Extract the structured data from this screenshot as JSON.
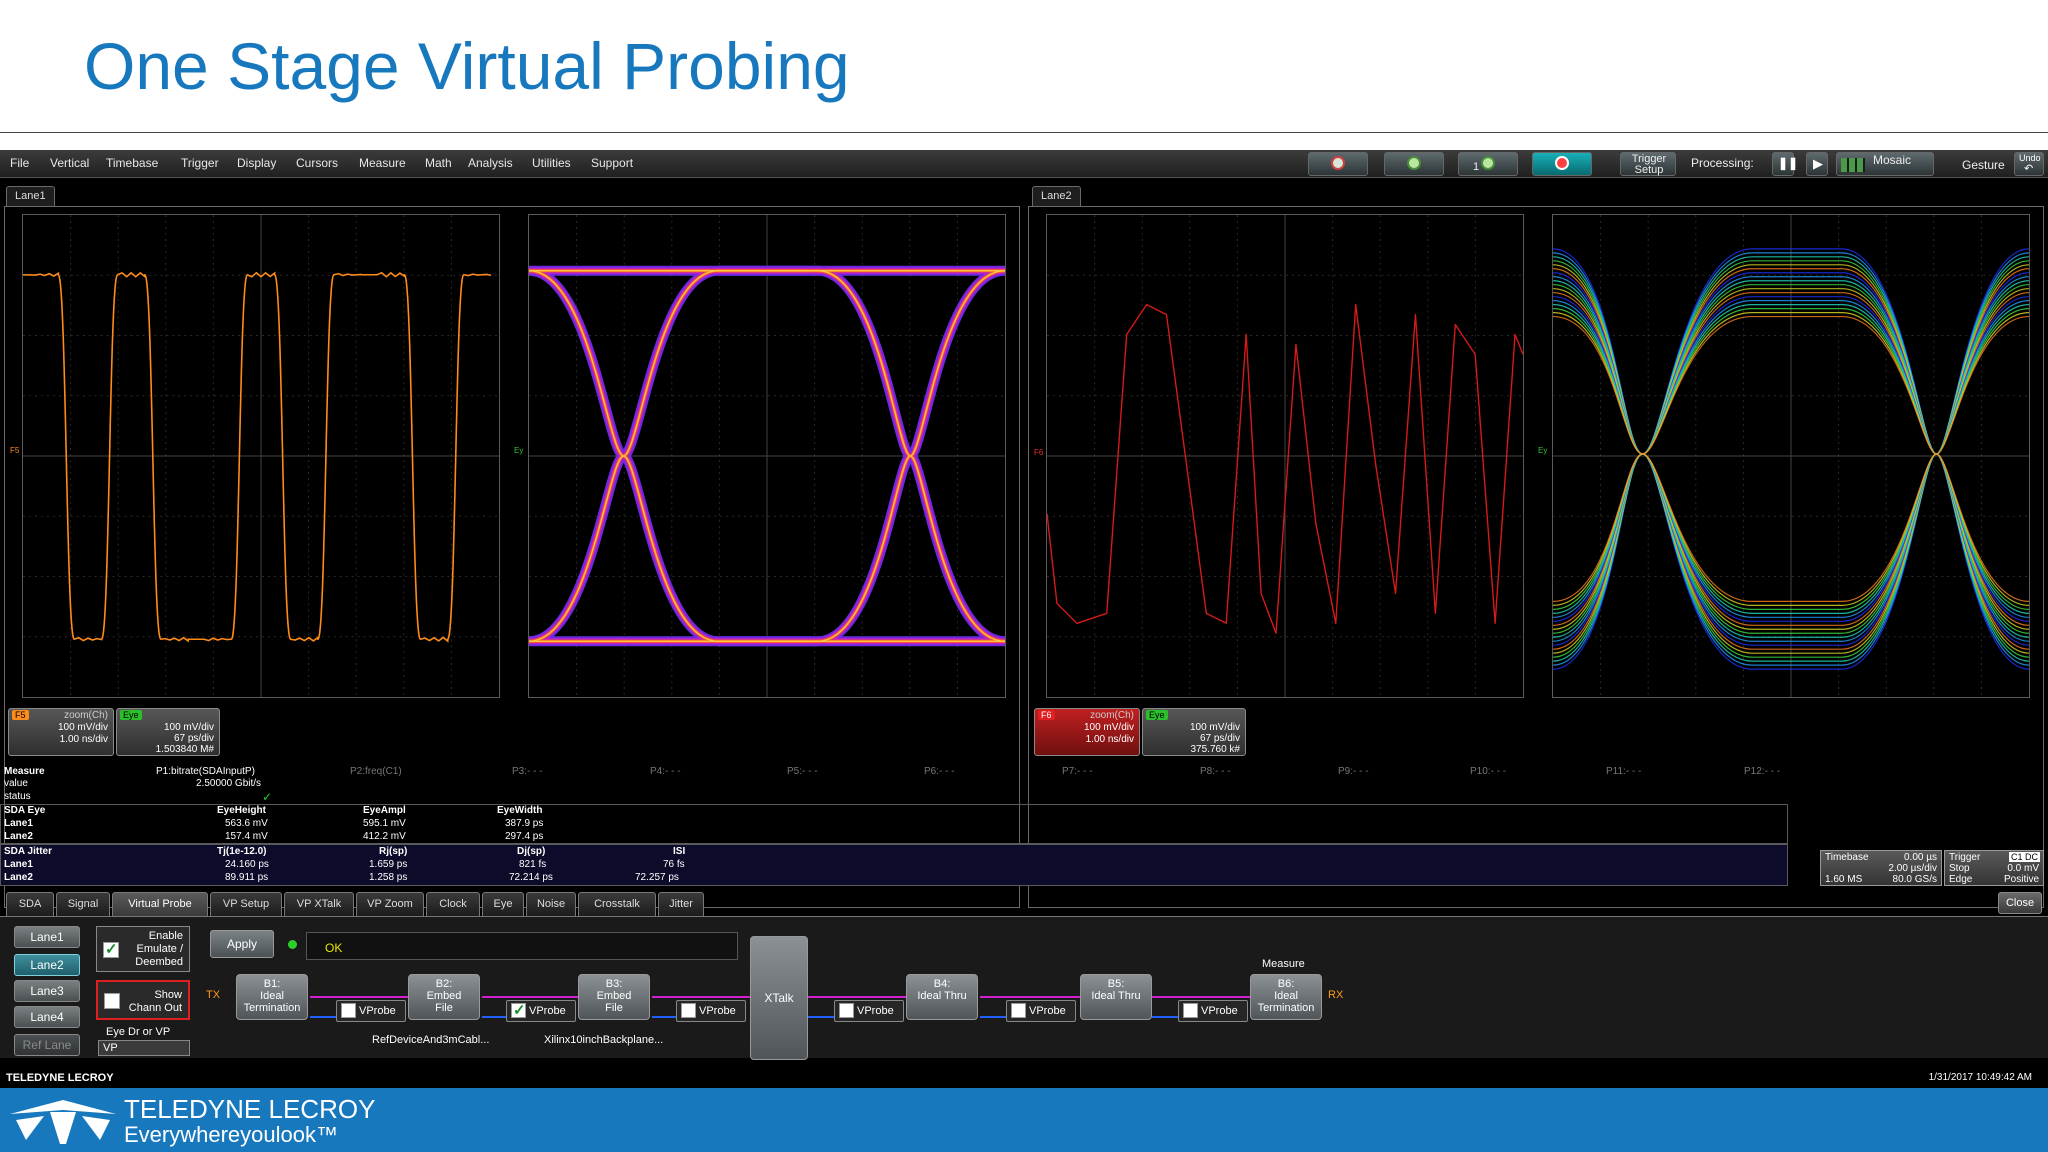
{
  "slide": {
    "title": "One Stage Virtual Probing"
  },
  "menu": [
    "File",
    "Vertical",
    "Timebase",
    "Trigger",
    "Display",
    "Cursors",
    "Measure",
    "Math",
    "Analysis",
    "Utilities",
    "Support"
  ],
  "toolbar": {
    "trigger_setup_line1": "Trigger",
    "trigger_setup_line2": "Setup",
    "processing_label": "Processing:",
    "mosaic_label": "Mosaic",
    "gesture_label": "Gesture",
    "undo_label": "Undo",
    "counter_label": "1"
  },
  "grids": {
    "lane1_tab": "Lane1",
    "lane2_tab": "Lane2",
    "marker_f5": "F5",
    "marker_f6": "F6",
    "marker_ey": "Ey",
    "lane1_zoom": {
      "tag": "F5",
      "name": "zoom(Ch)",
      "v": "100 mV/div",
      "t": "1.00 ns/div"
    },
    "lane1_eye": {
      "tag": "Eye",
      "v": "100 mV/div",
      "t": "67 ps/div",
      "n": "1.503840 M#"
    },
    "lane2_zoom": {
      "tag": "F6",
      "name": "zoom(Ch)",
      "v": "100 mV/div",
      "t": "1.00 ns/div"
    },
    "lane2_eye": {
      "tag": "Eye",
      "v": "100 mV/div",
      "t": "67 ps/div",
      "n": "375.760 k#"
    }
  },
  "colors": {
    "lane1_trace": "#ff8c1a",
    "lane2_trace": "#d41a1a",
    "accent_blue": "#1778be",
    "flow_magenta": "#d020d0",
    "flow_blue": "#2060ff"
  },
  "measure": {
    "header": "Measure",
    "row_value": "value",
    "row_status": "status",
    "p1": "P1:bitrate(SDAInputP)",
    "p1_value": "2.50000 Gbit/s",
    "params": [
      "P2:freq(C1)",
      "P3:- - -",
      "P4:- - -",
      "P5:- - -",
      "P6:- - -",
      "P7:- - -",
      "P8:- - -",
      "P9:- - -",
      "P10:- - -",
      "P11:- - -",
      "P12:- - -"
    ]
  },
  "sda_eye": {
    "title": "SDA Eye",
    "cols": [
      "EyeHeight",
      "EyeAmpl",
      "EyeWidth"
    ],
    "rows": [
      {
        "name": "Lane1",
        "vals": [
          "563.6 mV",
          "595.1 mV",
          "387.9 ps"
        ]
      },
      {
        "name": "Lane2",
        "vals": [
          "157.4 mV",
          "412.2 mV",
          "297.4 ps"
        ]
      }
    ]
  },
  "sda_jitter": {
    "title": "SDA Jitter",
    "cols": [
      "Tj(1e-12.0)",
      "Rj(sp)",
      "Dj(sp)",
      "ISI"
    ],
    "rows": [
      {
        "name": "Lane1",
        "vals": [
          "24.160 ps",
          "1.659 ps",
          "821 fs",
          "76 fs"
        ]
      },
      {
        "name": "Lane2",
        "vals": [
          "89.911 ps",
          "1.258 ps",
          "72.214 ps",
          "72.257 ps"
        ]
      }
    ]
  },
  "timebase": {
    "label": "Timebase",
    "delay": "0.00 µs",
    "div": "2.00 µs/div",
    "samples": "1.60 MS",
    "rate": "80.0 GS/s"
  },
  "trigger": {
    "label": "Trigger",
    "badge": "C1 DC",
    "mode": "Stop",
    "level": "0.0 mV",
    "type": "Edge",
    "slope": "Positive"
  },
  "dialog": {
    "tabs": [
      "SDA",
      "Signal",
      "Virtual Probe",
      "VP Setup",
      "VP XTalk",
      "VP Zoom",
      "Clock",
      "Eye",
      "Noise",
      "Crosstalk",
      "Jitter"
    ],
    "close": "Close",
    "lanes": [
      "Lane1",
      "Lane2",
      "Lane3",
      "Lane4",
      "Ref Lane"
    ],
    "enable_label": [
      "Enable",
      "Emulate /",
      "Deembed"
    ],
    "show_label": [
      "Show",
      "Chann Out"
    ],
    "eye_dr_label": "Eye Dr or VP",
    "eye_dr_value": "VP",
    "apply": "Apply",
    "status": "OK",
    "tx": "TX",
    "rx": "RX",
    "measure_label": "Measure",
    "xtalk": "XTalk",
    "vprobe_label": "VProbe",
    "blocks": [
      {
        "id": "B1:",
        "line1": "Ideal",
        "line2": "Termination"
      },
      {
        "id": "B2:",
        "line1": "Embed",
        "line2": "File"
      },
      {
        "id": "B3:",
        "line1": "Embed",
        "line2": "File"
      },
      {
        "id": "B4:",
        "line1": "Ideal Thru",
        "line2": ""
      },
      {
        "id": "B5:",
        "line1": "Ideal Thru",
        "line2": ""
      },
      {
        "id": "B6:",
        "line1": "Ideal",
        "line2": "Termination"
      }
    ],
    "file1": "RefDeviceAnd3mCabl...",
    "file2": "Xilinx10inchBackplane..."
  },
  "status_bar": {
    "brand": "TELEDYNE LECROY",
    "datetime": "1/31/2017 10:49:42 AM"
  },
  "footer": {
    "logo_line1": "TELEDYNE LECROY",
    "tagline": "Everywhereyoulook™"
  }
}
